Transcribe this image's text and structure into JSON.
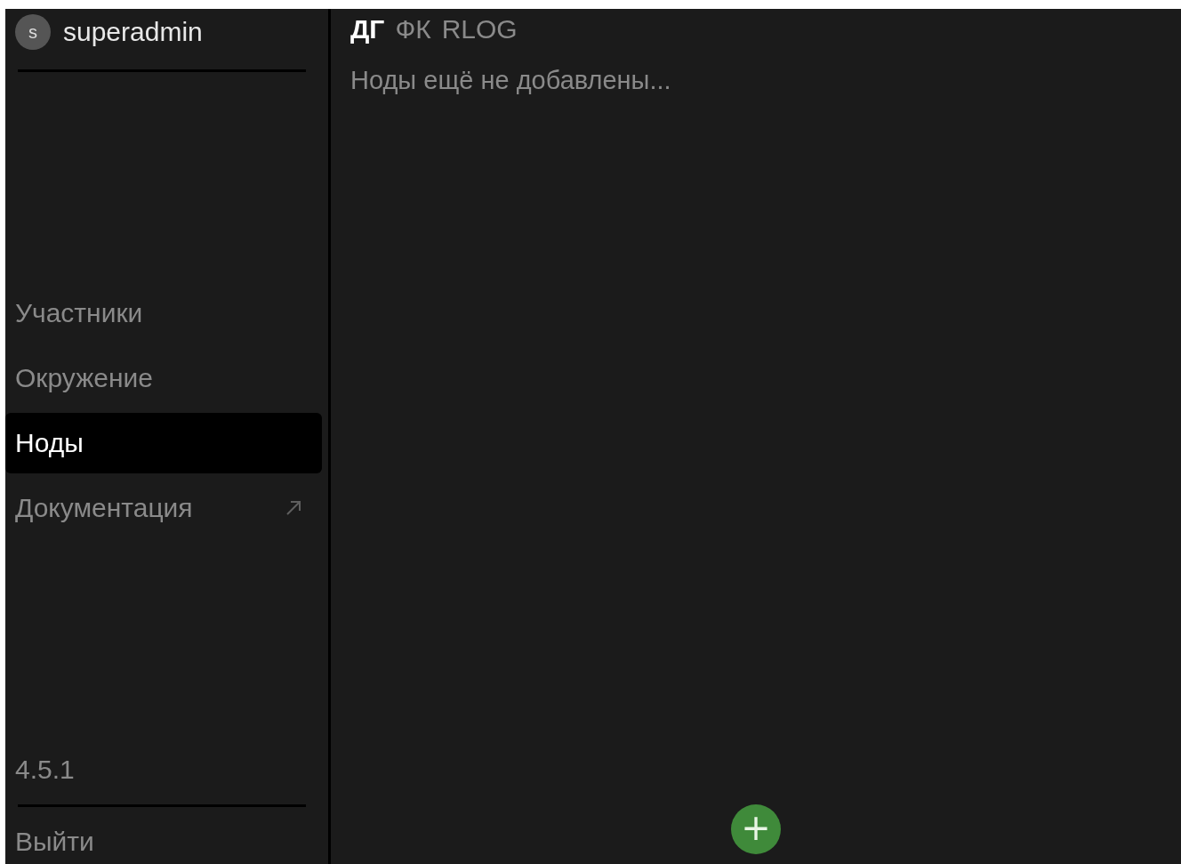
{
  "user": {
    "avatar_letter": "s",
    "name": "superadmin"
  },
  "sidebar": {
    "items": [
      {
        "label": "Участники",
        "selected": false,
        "external": false
      },
      {
        "label": "Окружение",
        "selected": false,
        "external": false
      },
      {
        "label": "Ноды",
        "selected": true,
        "external": false
      },
      {
        "label": "Документация",
        "selected": false,
        "external": true
      }
    ],
    "version": "4.5.1",
    "logout": "Выйти"
  },
  "tabs": [
    {
      "label": "ДГ",
      "selected": true
    },
    {
      "label": "ФК",
      "selected": false
    },
    {
      "label": "RLOG",
      "selected": false
    }
  ],
  "empty_message": "Ноды ещё не добавлены...",
  "add_button": "+"
}
